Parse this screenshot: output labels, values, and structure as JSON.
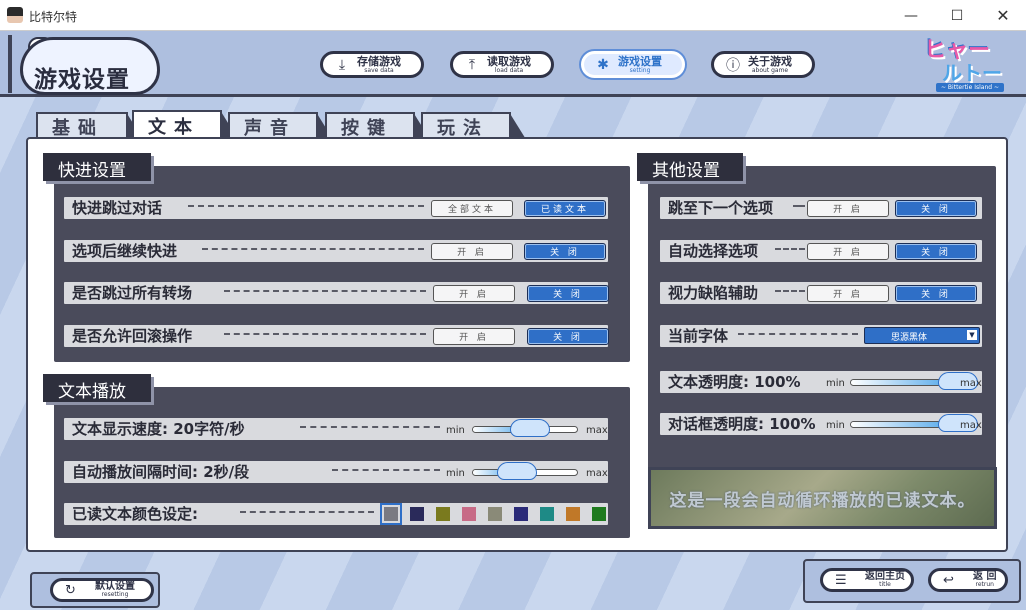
{
  "window": {
    "title": "比特尔特",
    "min": "—",
    "max": "☐",
    "close": "✕"
  },
  "header": {
    "logo_title": "游戏设置",
    "brand": {
      "line1": "ヒャー",
      "line2": "ルトー",
      "tag": "~ Bittertie Island ~"
    },
    "buttons": [
      {
        "main": "存储游戏",
        "sub": "save data",
        "icon": "download-icon",
        "glyph": "⤓"
      },
      {
        "main": "读取游戏",
        "sub": "load data",
        "icon": "upload-icon",
        "glyph": "⤒"
      },
      {
        "main": "游戏设置",
        "sub": "setting",
        "icon": "gear-icon",
        "glyph": "✱",
        "active": true
      },
      {
        "main": "关于游戏",
        "sub": "about game",
        "icon": "info-icon",
        "glyph": "ⓘ"
      }
    ]
  },
  "tabs": [
    {
      "label": "基础"
    },
    {
      "label": "文本",
      "active": true
    },
    {
      "label": "声音"
    },
    {
      "label": "按键"
    },
    {
      "label": "玩法"
    }
  ],
  "skip_settings": {
    "title": "快进设置",
    "rows": [
      {
        "label": "快进跳过对话",
        "options": [
          "全部文本",
          "已读文本"
        ],
        "selected": 1
      },
      {
        "label": "选项后继续快进",
        "options": [
          "开 启",
          "关 闭"
        ],
        "selected": 1
      },
      {
        "label": "是否跳过所有转场",
        "options": [
          "开 启",
          "关 闭"
        ],
        "selected": 1
      },
      {
        "label": "是否允许回滚操作",
        "options": [
          "开 启",
          "关 闭"
        ],
        "selected": 1
      }
    ]
  },
  "text_playback": {
    "title": "文本播放",
    "speed": {
      "label": "文本显示速度:  20字符/秒",
      "min": "min",
      "max": "max",
      "level": 0.55
    },
    "auto": {
      "label": "自动播放间隔时间:  2秒/段",
      "min": "min",
      "max": "max",
      "level": 0.42
    },
    "color": {
      "label": "已读文本颜色设定:",
      "swatches": [
        "#7a7a82",
        "#2a2a5a",
        "#7a7a1e",
        "#c76a86",
        "#8a8a78",
        "#2a2a78",
        "#1e8a86",
        "#c07828",
        "#1e7a1e"
      ],
      "selected": 0
    }
  },
  "other_settings": {
    "title": "其他设置",
    "rows": [
      {
        "label": "跳至下一个选项",
        "options": [
          "开 启",
          "关 闭"
        ],
        "selected": 1
      },
      {
        "label": "自动选择选项",
        "options": [
          "开 启",
          "关 闭"
        ],
        "selected": 1
      },
      {
        "label": "视力缺陷辅助",
        "options": [
          "开 启",
          "关 闭"
        ],
        "selected": 1
      }
    ],
    "font": {
      "label": "当前字体",
      "value": "思源黑体",
      "arrow": "▼"
    },
    "text_opacity": {
      "label": "文本透明度: 100%",
      "min": "min",
      "max": "max",
      "level": 1.0
    },
    "box_opacity": {
      "label": "对话框透明度: 100%",
      "min": "min",
      "max": "max",
      "level": 1.0
    }
  },
  "preview_text": "这是一段会自动循环播放的已读文本。",
  "bottom": {
    "reset": {
      "main": "默认设置",
      "sub": "resetting",
      "glyph": "↻"
    },
    "title": {
      "main": "返回主页",
      "sub": "title",
      "glyph": "☰"
    },
    "back": {
      "main": "返 回",
      "sub": "retrun",
      "glyph": "↩"
    }
  }
}
